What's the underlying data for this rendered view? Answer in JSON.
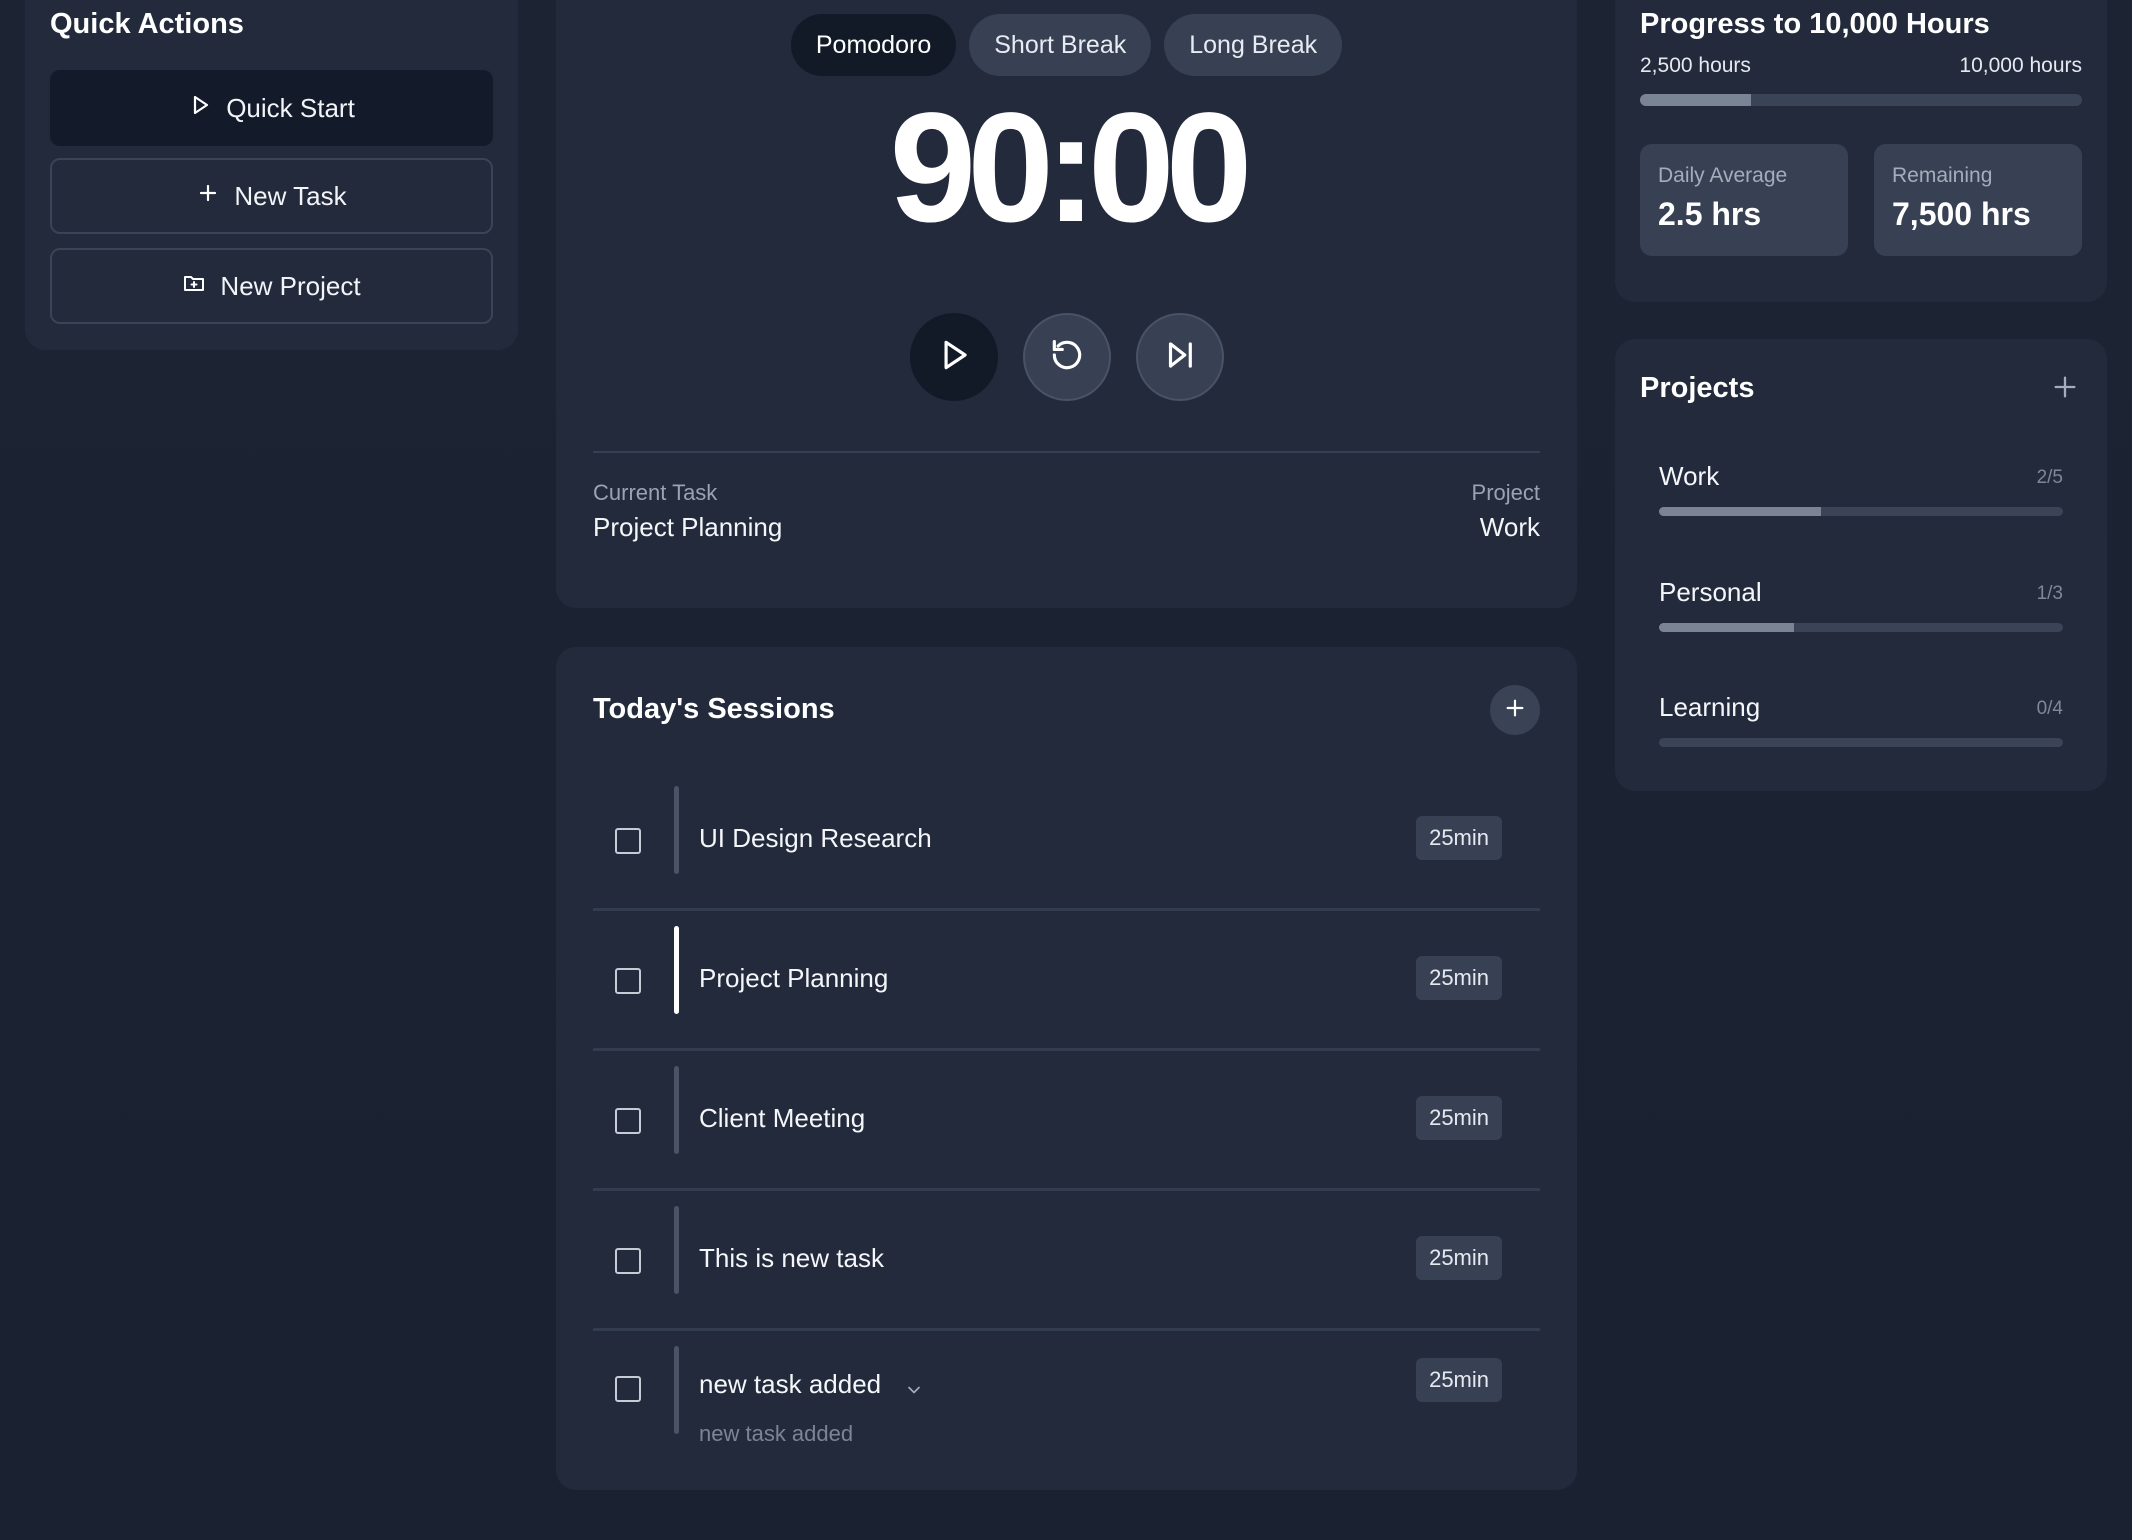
{
  "quick_actions": {
    "title": "Quick Actions",
    "quick_start": "Quick Start",
    "new_task": "New Task",
    "new_project": "New Project"
  },
  "timer": {
    "modes": [
      "Pomodoro",
      "Short Break",
      "Long Break"
    ],
    "active_mode": "Pomodoro",
    "time": "90:00",
    "current_task_label": "Current Task",
    "current_task": "Project Planning",
    "project_label": "Project",
    "project": "Work"
  },
  "sessions": {
    "title": "Today's Sessions",
    "items": [
      {
        "name": "UI Design Research",
        "duration": "25min"
      },
      {
        "name": "Project Planning",
        "duration": "25min",
        "current": true
      },
      {
        "name": "Client Meeting",
        "duration": "25min"
      },
      {
        "name": "This is new task",
        "duration": "25min"
      },
      {
        "name": "new task added",
        "duration": "25min",
        "description": "new task added",
        "expanded": true
      }
    ]
  },
  "progress": {
    "title": "Progress to 10,000 Hours",
    "start_label": "2,500 hours",
    "end_label": "10,000 hours",
    "fraction": 0.25,
    "daily_average_label": "Daily Average",
    "daily_average": "2.5 hrs",
    "remaining_label": "Remaining",
    "remaining": "7,500 hrs"
  },
  "projects": {
    "title": "Projects",
    "items": [
      {
        "name": "Work",
        "count": "2/5",
        "fraction": 0.4
      },
      {
        "name": "Personal",
        "count": "1/3",
        "fraction": 0.333
      },
      {
        "name": "Learning",
        "count": "0/4",
        "fraction": 0
      }
    ]
  },
  "colors": {
    "background": "#1c2434",
    "card": "#222a3b",
    "accent_dark": "#121927",
    "chip": "#384154",
    "progress_fill": "#7b8494"
  }
}
